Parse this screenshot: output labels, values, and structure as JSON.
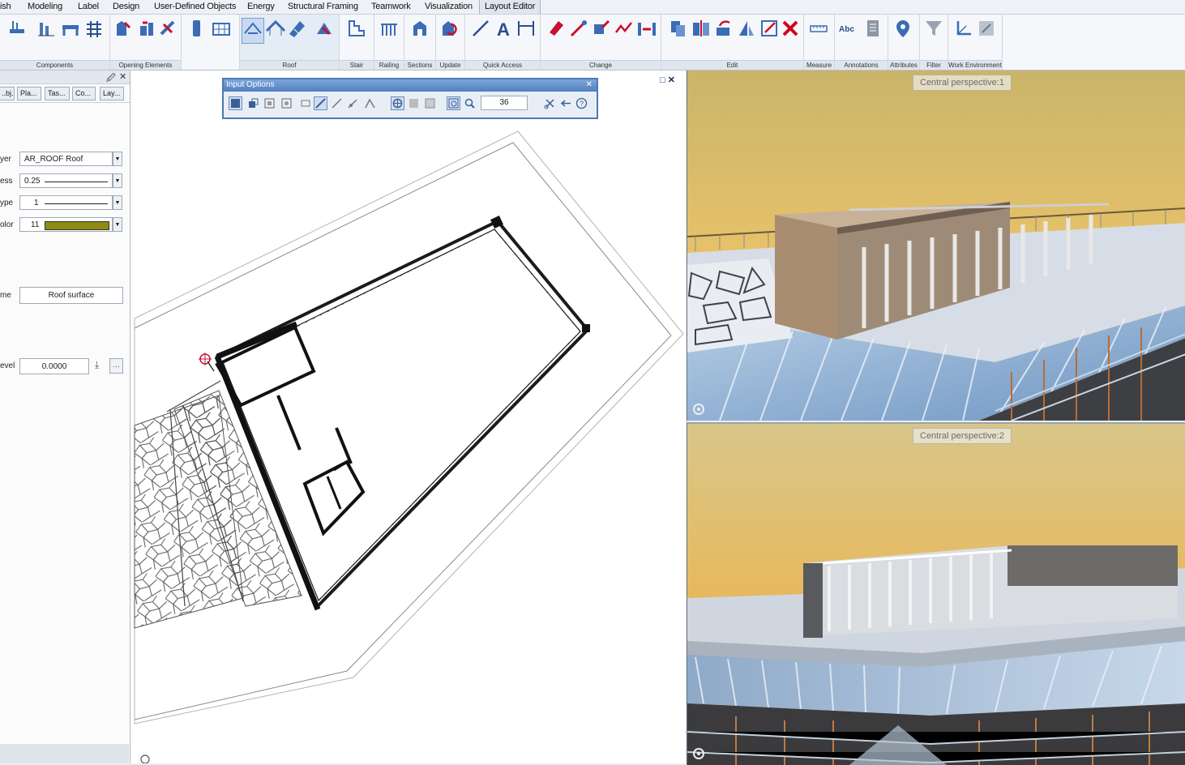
{
  "ribbon_tabs": [
    "ish",
    "Modeling",
    "Label",
    "Design",
    "User-Defined Objects",
    "Energy",
    "Structural Framing",
    "Teamwork",
    "Visualization",
    "Layout Editor"
  ],
  "active_tab": "Layout Editor",
  "ribbon_groups": [
    "Components",
    "Opening Elements",
    "Roof",
    "Stair",
    "Railing",
    "Sections",
    "Update",
    "Quick Access",
    "Change",
    "Edit",
    "Measure",
    "Annotations",
    "Attributes",
    "Filter",
    "Work Environment"
  ],
  "left_panel": {
    "tabs": [
      "..bj..",
      "Pla...",
      "Tas...",
      "Co...",
      "Lay..."
    ],
    "properties": [
      {
        "label": "yer",
        "value": "AR_ROOF  Roof"
      },
      {
        "label": "ess",
        "value": "0.25"
      },
      {
        "label": "ype",
        "value": "1"
      },
      {
        "label": "olor",
        "value": "11"
      }
    ],
    "name_label": "me",
    "name_value": "Roof surface",
    "level_label": "evel",
    "level_value": "0.0000",
    "colors": {
      "pen_color": "#8f8a16"
    }
  },
  "input_options": {
    "title": "Input Options",
    "value": "36"
  },
  "viewports": [
    {
      "label": "Central perspective:1"
    },
    {
      "label": "Central perspective:2"
    }
  ],
  "colors": {
    "accent": "#4f7fc1",
    "ribbon_bg": "#f5f7fa",
    "active_tab_bg": "#dde6f1"
  }
}
